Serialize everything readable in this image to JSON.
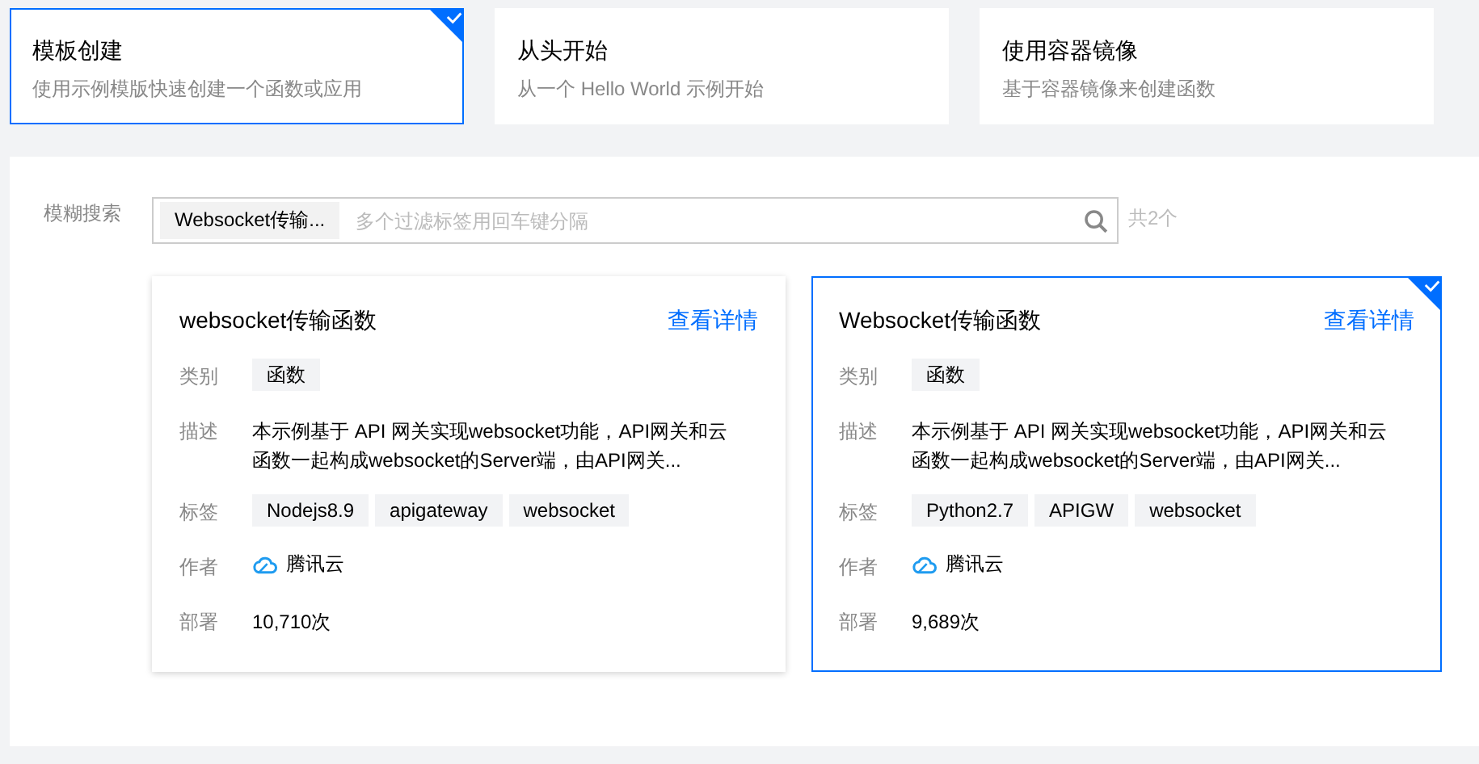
{
  "creation_modes": [
    {
      "title": "模板创建",
      "description": "使用示例模版快速创建一个函数或应用",
      "selected": true
    },
    {
      "title": "从头开始",
      "description": "从一个 Hello World 示例开始",
      "selected": false
    },
    {
      "title": "使用容器镜像",
      "description": "基于容器镜像来创建函数",
      "selected": false
    }
  ],
  "search": {
    "label": "模糊搜索",
    "tag": "Websocket传输...",
    "placeholder": "多个过滤标签用回车键分隔",
    "count": "共2个"
  },
  "templates": [
    {
      "title": "websocket传输函数",
      "details_link": "查看详情",
      "selected": false,
      "fields": [
        {
          "label": "类别",
          "kind": "chips",
          "values": [
            "函数"
          ]
        },
        {
          "label": "描述",
          "kind": "text",
          "value": "本示例基于 API 网关实现websocket功能，API网关和云函数一起构成websocket的Server端，由API网关..."
        },
        {
          "label": "标签",
          "kind": "chips",
          "values": [
            "Nodejs8.9",
            "apigateway",
            "websocket"
          ]
        },
        {
          "label": "作者",
          "kind": "author",
          "value": "腾讯云"
        },
        {
          "label": "部署",
          "kind": "text",
          "value": "10,710次"
        }
      ]
    },
    {
      "title": "Websocket传输函数",
      "details_link": "查看详情",
      "selected": true,
      "fields": [
        {
          "label": "类别",
          "kind": "chips",
          "values": [
            "函数"
          ]
        },
        {
          "label": "描述",
          "kind": "text",
          "value": "本示例基于 API 网关实现websocket功能，API网关和云函数一起构成websocket的Server端，由API网关..."
        },
        {
          "label": "标签",
          "kind": "chips",
          "values": [
            "Python2.7",
            "APIGW",
            "websocket"
          ]
        },
        {
          "label": "作者",
          "kind": "author",
          "value": "腾讯云"
        },
        {
          "label": "部署",
          "kind": "text",
          "value": "9,689次"
        }
      ]
    }
  ]
}
